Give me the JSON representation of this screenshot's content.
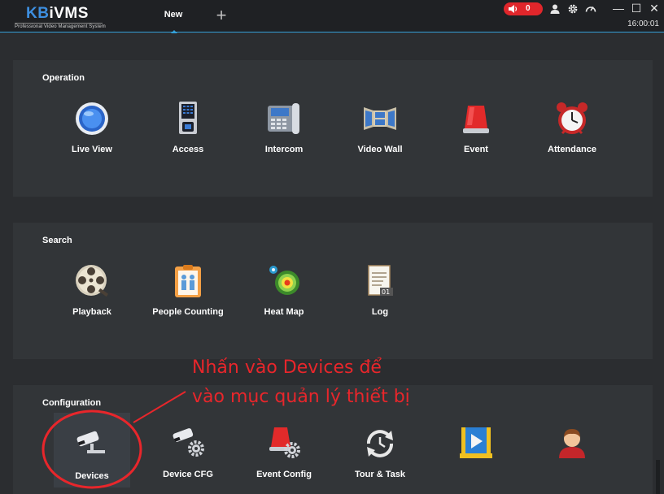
{
  "app": {
    "logo_brand_a": "KB",
    "logo_brand_b": "iVMS",
    "logo_subtitle": "Professional Video Management System",
    "tab_label": "New",
    "tab_add": "+",
    "alarm_count": "0",
    "clock": "16:00:01",
    "win_min": "—",
    "win_max": "☐",
    "win_close": "✕",
    "accent_color": "#34a0d8",
    "alarm_color": "#e0262b"
  },
  "sections": {
    "operation": {
      "title": "Operation",
      "items": [
        {
          "label": "Live View",
          "icon": "live-view-icon"
        },
        {
          "label": "Access",
          "icon": "access-icon"
        },
        {
          "label": "Intercom",
          "icon": "intercom-icon"
        },
        {
          "label": "Video Wall",
          "icon": "video-wall-icon"
        },
        {
          "label": "Event",
          "icon": "event-icon"
        },
        {
          "label": "Attendance",
          "icon": "alarm-clock-icon"
        }
      ]
    },
    "search": {
      "title": "Search",
      "items": [
        {
          "label": "Playback",
          "icon": "film-reel-icon"
        },
        {
          "label": "People Counting",
          "icon": "people-counting-icon"
        },
        {
          "label": "Heat Map",
          "icon": "heat-map-icon"
        },
        {
          "label": "Log",
          "icon": "log-icon"
        }
      ]
    },
    "configuration": {
      "title": "Configuration",
      "items": [
        {
          "label": "Devices",
          "icon": "camera-icon"
        },
        {
          "label": "Device CFG",
          "icon": "camera-gear-icon"
        },
        {
          "label": "Event Config",
          "icon": "event-gear-icon"
        },
        {
          "label": "Tour & Task",
          "icon": "tour-task-icon"
        },
        {
          "label": "",
          "icon": "video-clip-icon"
        },
        {
          "label": "",
          "icon": "user-icon"
        }
      ]
    }
  },
  "annotation": {
    "line1": "Nhấn vào Devices để",
    "line2": "vào mục quản lý thiết bị",
    "color": "#e8262b"
  }
}
